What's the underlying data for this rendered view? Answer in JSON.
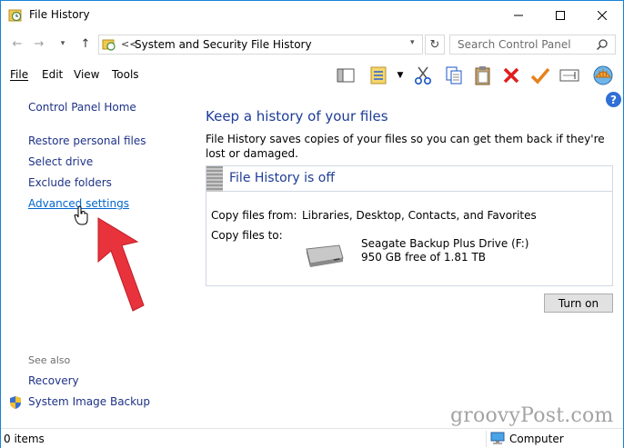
{
  "window": {
    "title": "File History"
  },
  "address": {
    "overflow": "<<",
    "crumbs": [
      "System and Security",
      "File History"
    ],
    "search_placeholder": "Search Control Panel"
  },
  "menu": {
    "file": "File",
    "edit": "Edit",
    "view": "View",
    "tools": "Tools"
  },
  "sidebar": {
    "home": "Control Panel Home",
    "links": [
      "Restore personal files",
      "Select drive",
      "Exclude folders",
      "Advanced settings"
    ],
    "see_also": "See also",
    "see_also_links": [
      "Recovery",
      "System Image Backup"
    ]
  },
  "main": {
    "heading": "Keep a history of your files",
    "description": "File History saves copies of your files so you can get them back if they're lost or damaged.",
    "status_title": "File History is off",
    "copy_from_label": "Copy files from:",
    "copy_from_value": "Libraries, Desktop, Contacts, and Favorites",
    "copy_to_label": "Copy files to:",
    "drive_name": "Seagate Backup Plus Drive (F:)",
    "drive_free": "950 GB free of 1.81 TB",
    "turn_on": "Turn on",
    "help": "?"
  },
  "statusbar": {
    "items": "0 items",
    "computer": "Computer"
  },
  "watermark": "groovyPost.com",
  "colors": {
    "accent_border": "#1883d7",
    "link": "#1e3287",
    "heading": "#1e3c96",
    "arrow": "#e8323c"
  },
  "icons": {
    "title": "file-history-icon",
    "search": "search-icon",
    "help": "help-icon",
    "shield": "shield-icon"
  }
}
